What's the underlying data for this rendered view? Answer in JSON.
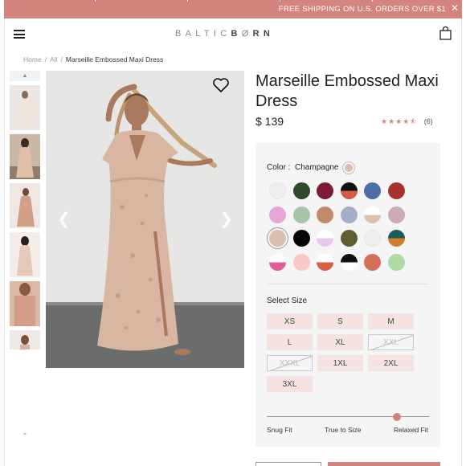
{
  "promo": {
    "text": "FREE SHIPPING ON U.S. ORDERS OVER $1",
    "close": "✕"
  },
  "header": {
    "logo_prefix": "BALTIC",
    "logo_b": "B",
    "logo_o": "Ø",
    "logo_rn": "RN"
  },
  "breadcrumb": {
    "home": "Home",
    "all": "All",
    "sep": "/",
    "current": "Marseille Embossed Maxi Dress"
  },
  "product": {
    "title": "Marseille Embossed Maxi Dress",
    "price": "$ 139",
    "stars": "★★★★⯪",
    "review_count": "(6)",
    "rating_value": 4.5
  },
  "color": {
    "label": "Color :",
    "selected": "Champagne",
    "swatches": [
      [
        "#eeeeee",
        "#2f4a2a",
        "#7d1a35",
        "split:#111111:#d65a45",
        "#4f6ea7",
        "#a8302d"
      ],
      [
        "#e6a5d8",
        "#a9c3ad",
        "#c48a6e",
        "#a3aec8",
        "split:#ffffff:#d9c2b0",
        "#ccaab6"
      ],
      [
        "#d9bfb0",
        "#050505",
        "split:#ffffff:#e7c8ef",
        "#5e5d33",
        "#eeeeee",
        "split:#185c5a:#d07d2c"
      ],
      [
        "split:#ffffff:#e35d98",
        "#f8c9c4",
        "split:#ffffff:#d85e48",
        "split:#111111:#ffffff",
        "split:#d46f5a:#d46f5a",
        "#addba3"
      ]
    ],
    "selected_index": [
      2,
      0
    ]
  },
  "size": {
    "label": "Select Size",
    "options": [
      {
        "label": "XS",
        "available": true
      },
      {
        "label": "S",
        "available": true
      },
      {
        "label": "M",
        "available": true
      },
      {
        "label": "L",
        "available": true
      },
      {
        "label": "XL",
        "available": true
      },
      {
        "label": "XXL",
        "available": false
      },
      {
        "label": "XXXL",
        "available": false
      },
      {
        "label": "1XL",
        "available": true
      },
      {
        "label": "2XL",
        "available": true
      },
      {
        "label": "3XL",
        "available": true
      }
    ]
  },
  "fit": {
    "left": "Snug Fit",
    "middle": "True to Size",
    "right": "Relaxed Fit",
    "level": 0.8
  },
  "colors": {
    "accent": "#d4847f",
    "panel": "#f5f5f5",
    "size_bg": "#f5e3e1"
  }
}
